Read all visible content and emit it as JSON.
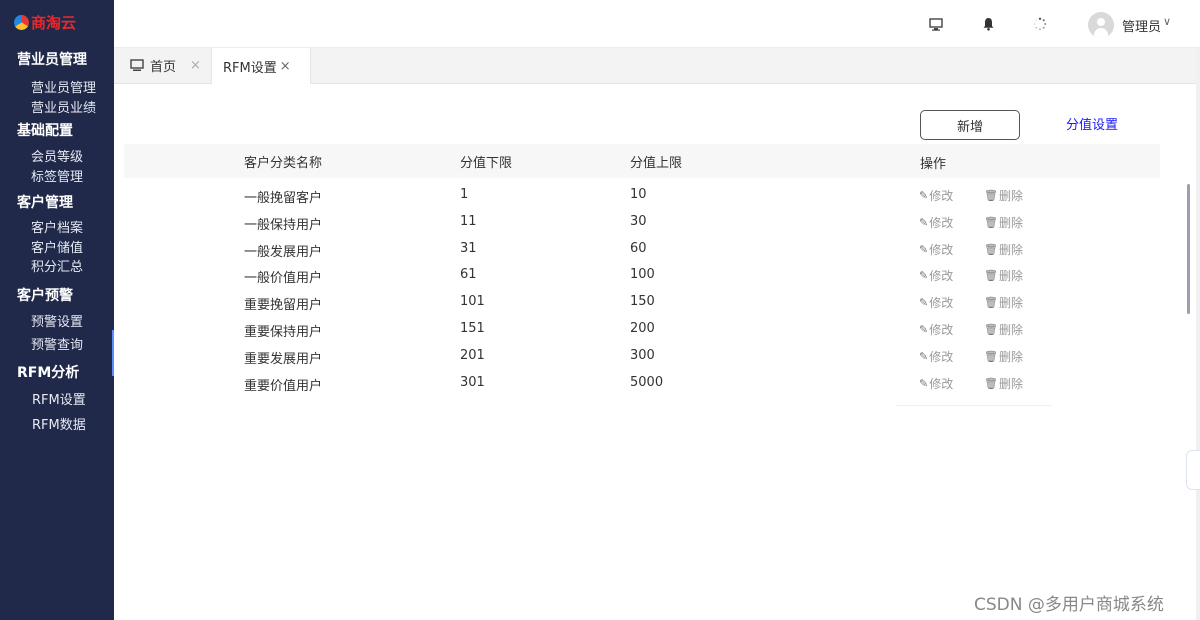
{
  "app": {
    "brand": "商淘云"
  },
  "sidebar": {
    "groups": [
      {
        "title": "营业员管理",
        "items": [
          "营业员管理",
          "营业员业绩"
        ]
      },
      {
        "title": "基础配置",
        "items": [
          "会员等级",
          "标签管理"
        ]
      },
      {
        "title": "客户管理",
        "items": [
          "客户档案",
          "客户储值",
          "积分汇总"
        ]
      },
      {
        "title": "客户预警",
        "items": [
          "预警设置",
          "预警查询"
        ]
      },
      {
        "title": "RFM分析",
        "items": [
          "RFM设置",
          "RFM数据"
        ]
      }
    ]
  },
  "header": {
    "icons": [
      "monitor-icon",
      "bell-icon",
      "loading-spinner-icon"
    ],
    "user": {
      "name": "管理员",
      "caret": "∨"
    }
  },
  "tabs": [
    {
      "label": "首页",
      "close": "×",
      "icon": "monitor-icon"
    },
    {
      "label": "RFM设置",
      "close": "×",
      "active": true
    }
  ],
  "toolbar": {
    "add_label": "新增",
    "score_settings_label": "分值设置"
  },
  "table": {
    "columns": [
      "客户分类名称",
      "分值下限",
      "分值上限",
      "操作"
    ],
    "rows": [
      {
        "name": "一般挽留客户",
        "min": "1",
        "max": "10"
      },
      {
        "name": "一般保持用户",
        "min": "11",
        "max": "30"
      },
      {
        "name": "一般发展用户",
        "min": "31",
        "max": "60"
      },
      {
        "name": "一般价值用户",
        "min": "61",
        "max": "100"
      },
      {
        "name": "重要挽留用户",
        "min": "101",
        "max": "150"
      },
      {
        "name": "重要保持用户",
        "min": "151",
        "max": "200"
      },
      {
        "name": "重要发展用户",
        "min": "201",
        "max": "300"
      },
      {
        "name": "重要价值用户",
        "min": "301",
        "max": "5000"
      }
    ],
    "actions": {
      "edit": "修改",
      "delete": "删除"
    }
  },
  "watermark": "CSDN @多用户商城系统",
  "colors": {
    "sidebar_bg": "#20294a",
    "brand_red": "#e8282a",
    "link_blue": "#1a1aff"
  }
}
